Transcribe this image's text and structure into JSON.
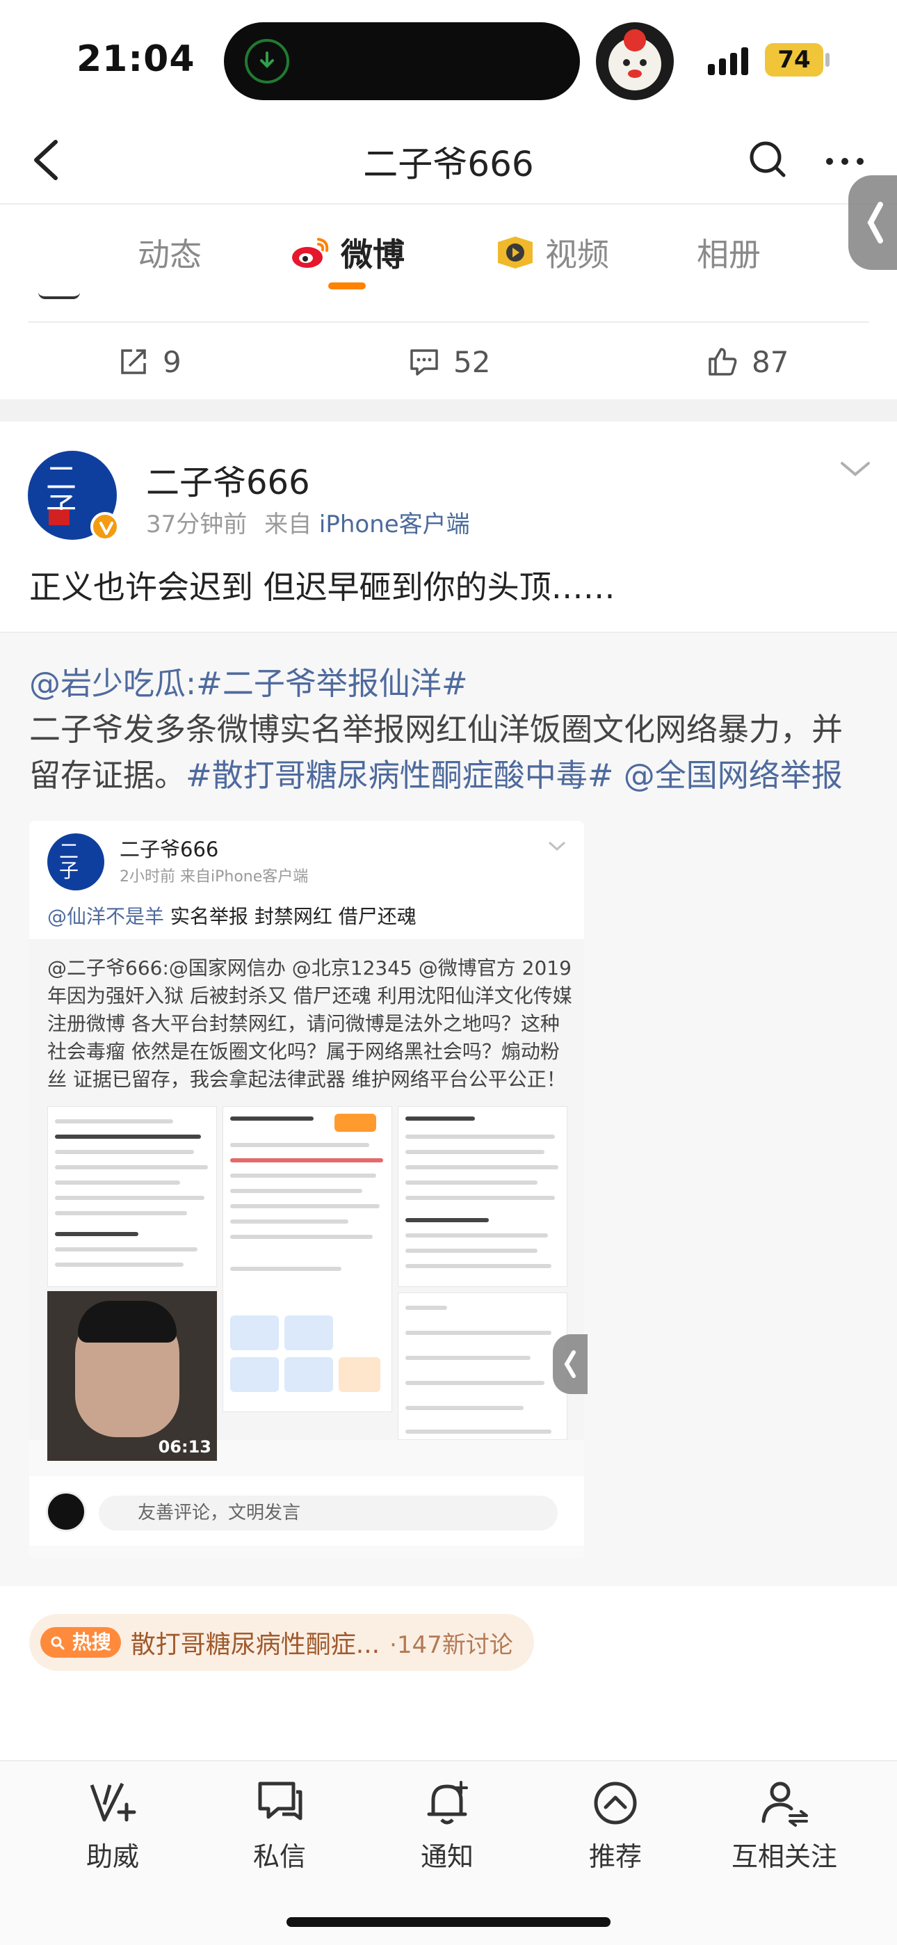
{
  "status_bar": {
    "time": "21:04",
    "battery": "74"
  },
  "nav": {
    "title": "二子爷666"
  },
  "tabs": [
    {
      "label": "动态",
      "active": false
    },
    {
      "label": "微博",
      "active": true
    },
    {
      "label": "视频",
      "active": false
    },
    {
      "label": "相册",
      "active": false
    }
  ],
  "previous_post": {
    "reposts": "9",
    "comments": "52",
    "likes": "87"
  },
  "post": {
    "author": "二子爷666",
    "time": "37分钟前",
    "source_prefix": "来自",
    "source": "iPhone客户端",
    "text": "正义也许会迟到 但迟早砸到你的头顶……",
    "repost": {
      "line1_mention": "@岩少吃瓜:",
      "line1_topic": "#二子爷举报仙洋#",
      "line2": "二子爷发多条微博实名举报网红仙洋饭圈文化网络暴力，并",
      "line3_text": "留存证据。",
      "line3_topic": "#散打哥糖尿病性酮症酸中毒#",
      "line3_mention": "@全国网络举报"
    }
  },
  "embedded": {
    "author": "二子爷666",
    "meta": "2小时前  来自iPhone客户端",
    "text_mention": "@仙洋不是羊",
    "text_rest": " 实名举报 封禁网红 借尸还魂",
    "body_lines": [
      "@二子爷666:@国家网信办 @北京12345 @微博官方 2019",
      "年因为强奸入狱 后被封杀又 借尸还魂 利用沈阳仙洋文化传媒",
      "注册微博 各大平台封禁网红，请问微博是法外之地吗？这种",
      "社会毒瘤 依然是在饭圈文化吗？属于网络黑社会吗？煽动粉",
      "丝 证据已留存，我会拿起法律武器 维护网络平台公平公正！"
    ],
    "video_duration": "06:13",
    "comment_placeholder": "友善评论，文明发言"
  },
  "hot_search": {
    "tag": "热搜",
    "text": "散打哥糖尿病性酮症...",
    "count": "·147新讨论"
  },
  "bottom_bar": [
    {
      "label": "助威",
      "icon": "cheer-icon"
    },
    {
      "label": "私信",
      "icon": "message-icon"
    },
    {
      "label": "通知",
      "icon": "bell-icon"
    },
    {
      "label": "推荐",
      "icon": "recommend-icon"
    },
    {
      "label": "互相关注",
      "icon": "follow-icon"
    }
  ],
  "colors": {
    "accent": "#ff8200",
    "link": "#4e6a9e",
    "hot_tag": "#ff8a3c"
  }
}
